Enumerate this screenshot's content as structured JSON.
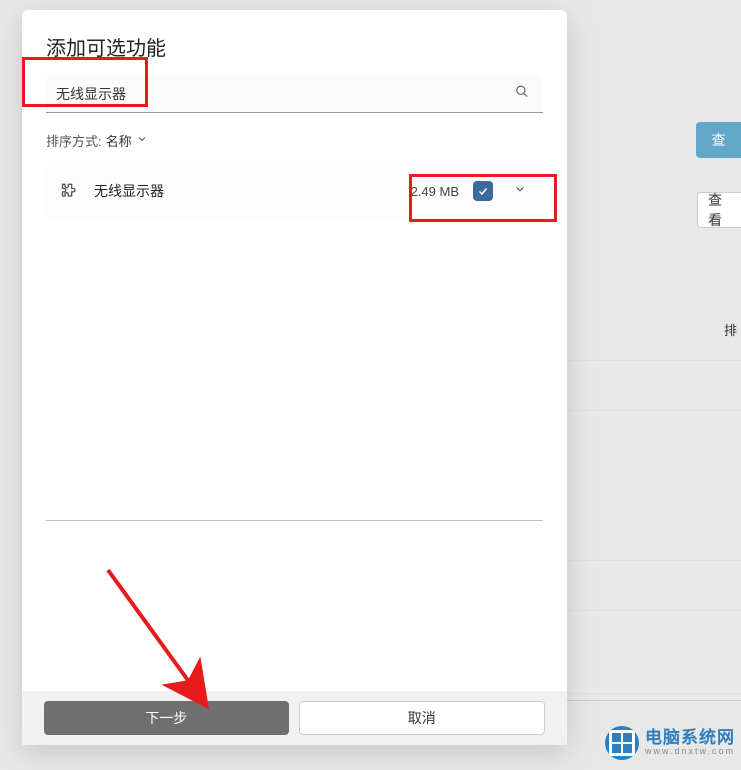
{
  "dialog": {
    "title": "添加可选功能",
    "search_value": "无线显示器",
    "sort_label": "排序方式:",
    "sort_value": "名称",
    "next_button": "下一步",
    "cancel_button": "取消"
  },
  "features": [
    {
      "name": "无线显示器",
      "size": "2.49 MB",
      "checked": true
    }
  ],
  "background": {
    "btn1_text": "查",
    "btn2_text": "查看",
    "sort_partial": "排"
  },
  "watermark": {
    "cn": "电脑系统网",
    "en": "www.dnxtw.com"
  }
}
